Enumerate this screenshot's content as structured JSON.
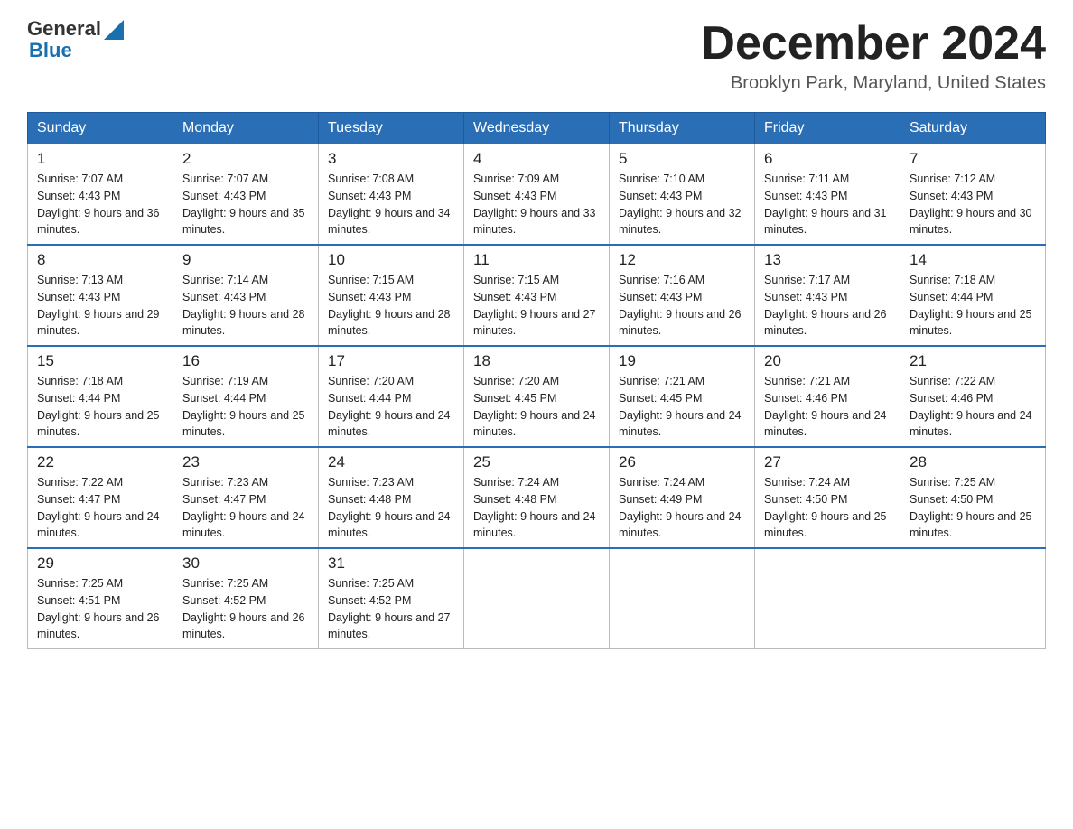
{
  "logo": {
    "text_general": "General",
    "text_blue": "Blue",
    "triangle_symbol": "▶"
  },
  "title": {
    "month_year": "December 2024",
    "location": "Brooklyn Park, Maryland, United States"
  },
  "weekdays": [
    "Sunday",
    "Monday",
    "Tuesday",
    "Wednesday",
    "Thursday",
    "Friday",
    "Saturday"
  ],
  "weeks": [
    [
      {
        "day": "1",
        "sunrise": "7:07 AM",
        "sunset": "4:43 PM",
        "daylight": "9 hours and 36 minutes."
      },
      {
        "day": "2",
        "sunrise": "7:07 AM",
        "sunset": "4:43 PM",
        "daylight": "9 hours and 35 minutes."
      },
      {
        "day": "3",
        "sunrise": "7:08 AM",
        "sunset": "4:43 PM",
        "daylight": "9 hours and 34 minutes."
      },
      {
        "day": "4",
        "sunrise": "7:09 AM",
        "sunset": "4:43 PM",
        "daylight": "9 hours and 33 minutes."
      },
      {
        "day": "5",
        "sunrise": "7:10 AM",
        "sunset": "4:43 PM",
        "daylight": "9 hours and 32 minutes."
      },
      {
        "day": "6",
        "sunrise": "7:11 AM",
        "sunset": "4:43 PM",
        "daylight": "9 hours and 31 minutes."
      },
      {
        "day": "7",
        "sunrise": "7:12 AM",
        "sunset": "4:43 PM",
        "daylight": "9 hours and 30 minutes."
      }
    ],
    [
      {
        "day": "8",
        "sunrise": "7:13 AM",
        "sunset": "4:43 PM",
        "daylight": "9 hours and 29 minutes."
      },
      {
        "day": "9",
        "sunrise": "7:14 AM",
        "sunset": "4:43 PM",
        "daylight": "9 hours and 28 minutes."
      },
      {
        "day": "10",
        "sunrise": "7:15 AM",
        "sunset": "4:43 PM",
        "daylight": "9 hours and 28 minutes."
      },
      {
        "day": "11",
        "sunrise": "7:15 AM",
        "sunset": "4:43 PM",
        "daylight": "9 hours and 27 minutes."
      },
      {
        "day": "12",
        "sunrise": "7:16 AM",
        "sunset": "4:43 PM",
        "daylight": "9 hours and 26 minutes."
      },
      {
        "day": "13",
        "sunrise": "7:17 AM",
        "sunset": "4:43 PM",
        "daylight": "9 hours and 26 minutes."
      },
      {
        "day": "14",
        "sunrise": "7:18 AM",
        "sunset": "4:44 PM",
        "daylight": "9 hours and 25 minutes."
      }
    ],
    [
      {
        "day": "15",
        "sunrise": "7:18 AM",
        "sunset": "4:44 PM",
        "daylight": "9 hours and 25 minutes."
      },
      {
        "day": "16",
        "sunrise": "7:19 AM",
        "sunset": "4:44 PM",
        "daylight": "9 hours and 25 minutes."
      },
      {
        "day": "17",
        "sunrise": "7:20 AM",
        "sunset": "4:44 PM",
        "daylight": "9 hours and 24 minutes."
      },
      {
        "day": "18",
        "sunrise": "7:20 AM",
        "sunset": "4:45 PM",
        "daylight": "9 hours and 24 minutes."
      },
      {
        "day": "19",
        "sunrise": "7:21 AM",
        "sunset": "4:45 PM",
        "daylight": "9 hours and 24 minutes."
      },
      {
        "day": "20",
        "sunrise": "7:21 AM",
        "sunset": "4:46 PM",
        "daylight": "9 hours and 24 minutes."
      },
      {
        "day": "21",
        "sunrise": "7:22 AM",
        "sunset": "4:46 PM",
        "daylight": "9 hours and 24 minutes."
      }
    ],
    [
      {
        "day": "22",
        "sunrise": "7:22 AM",
        "sunset": "4:47 PM",
        "daylight": "9 hours and 24 minutes."
      },
      {
        "day": "23",
        "sunrise": "7:23 AM",
        "sunset": "4:47 PM",
        "daylight": "9 hours and 24 minutes."
      },
      {
        "day": "24",
        "sunrise": "7:23 AM",
        "sunset": "4:48 PM",
        "daylight": "9 hours and 24 minutes."
      },
      {
        "day": "25",
        "sunrise": "7:24 AM",
        "sunset": "4:48 PM",
        "daylight": "9 hours and 24 minutes."
      },
      {
        "day": "26",
        "sunrise": "7:24 AM",
        "sunset": "4:49 PM",
        "daylight": "9 hours and 24 minutes."
      },
      {
        "day": "27",
        "sunrise": "7:24 AM",
        "sunset": "4:50 PM",
        "daylight": "9 hours and 25 minutes."
      },
      {
        "day": "28",
        "sunrise": "7:25 AM",
        "sunset": "4:50 PM",
        "daylight": "9 hours and 25 minutes."
      }
    ],
    [
      {
        "day": "29",
        "sunrise": "7:25 AM",
        "sunset": "4:51 PM",
        "daylight": "9 hours and 26 minutes."
      },
      {
        "day": "30",
        "sunrise": "7:25 AM",
        "sunset": "4:52 PM",
        "daylight": "9 hours and 26 minutes."
      },
      {
        "day": "31",
        "sunrise": "7:25 AM",
        "sunset": "4:52 PM",
        "daylight": "9 hours and 27 minutes."
      },
      null,
      null,
      null,
      null
    ]
  ]
}
